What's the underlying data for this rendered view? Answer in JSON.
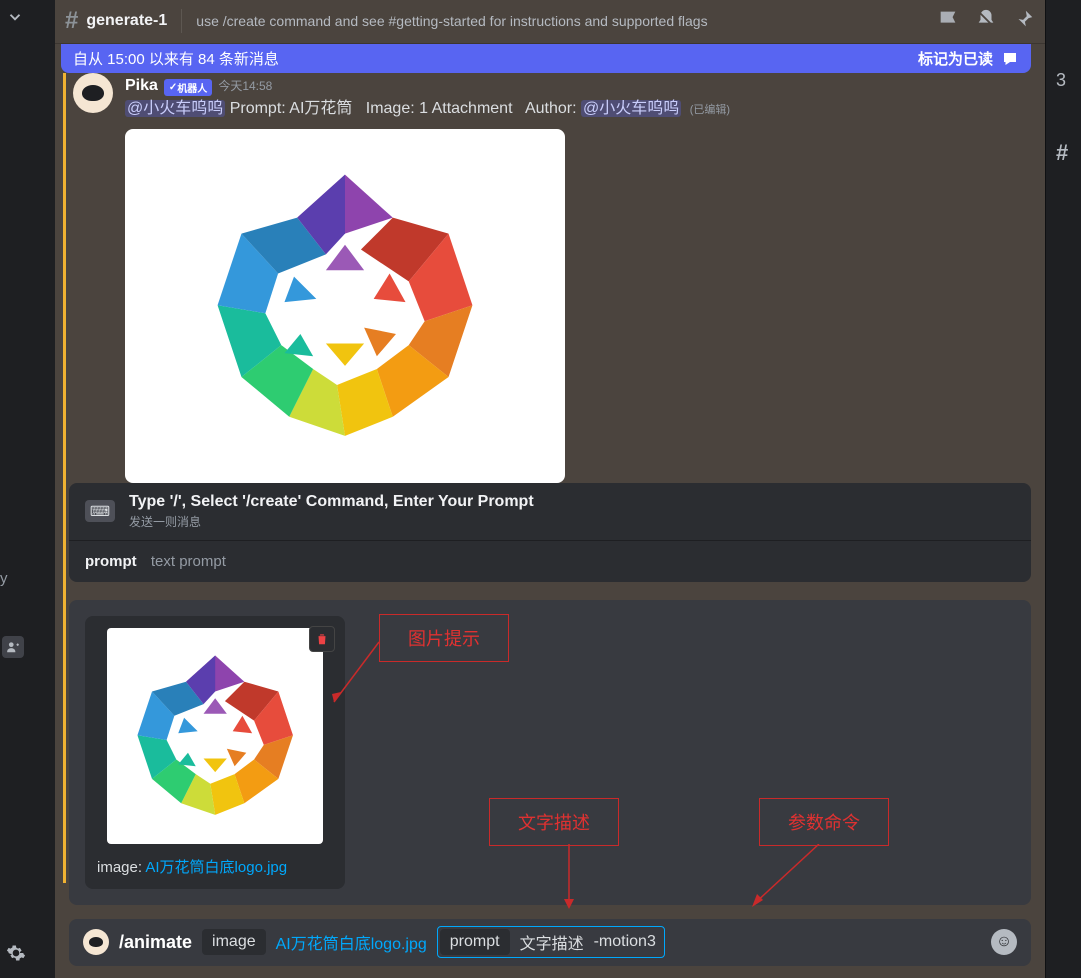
{
  "header": {
    "channel_name": "generate-1",
    "topic": "use /create command and see #getting-started for instructions and supported flags"
  },
  "new_messages_bar": {
    "text": "自从 15:00 以来有 84 条新消息",
    "mark_read": "标记为已读"
  },
  "message": {
    "username": "Pika",
    "bot_tag": "机器人",
    "timestamp": "今天14:58",
    "mention1": "@小火车呜呜",
    "prompt_label": "Prompt:",
    "prompt_value": "AI万花筒",
    "image_label": "Image:",
    "image_value": "1 Attachment",
    "author_label": "Author:",
    "mention2": "@小火车呜呜",
    "edited": "(已编辑)"
  },
  "command_hint": {
    "title": "Type '/', Select '/create' Command, Enter Your Prompt",
    "subtitle": "发送一则消息"
  },
  "option_row": {
    "label": "prompt",
    "desc": "text prompt"
  },
  "upload": {
    "prefix": "image: ",
    "filename": "AI万花筒白底logo.jpg"
  },
  "annotations": {
    "image_hint": "图片提示",
    "text_desc": "文字描述",
    "param_cmd": "参数命令"
  },
  "input_bar": {
    "command": "/animate",
    "chip_image": "image",
    "chip_file": "AI万花筒白底logo.jpg",
    "chip_prompt": "prompt",
    "text_desc": "文字描述",
    "motion": "-motion3"
  },
  "right_panel": {
    "count": "3",
    "hash": "#"
  }
}
